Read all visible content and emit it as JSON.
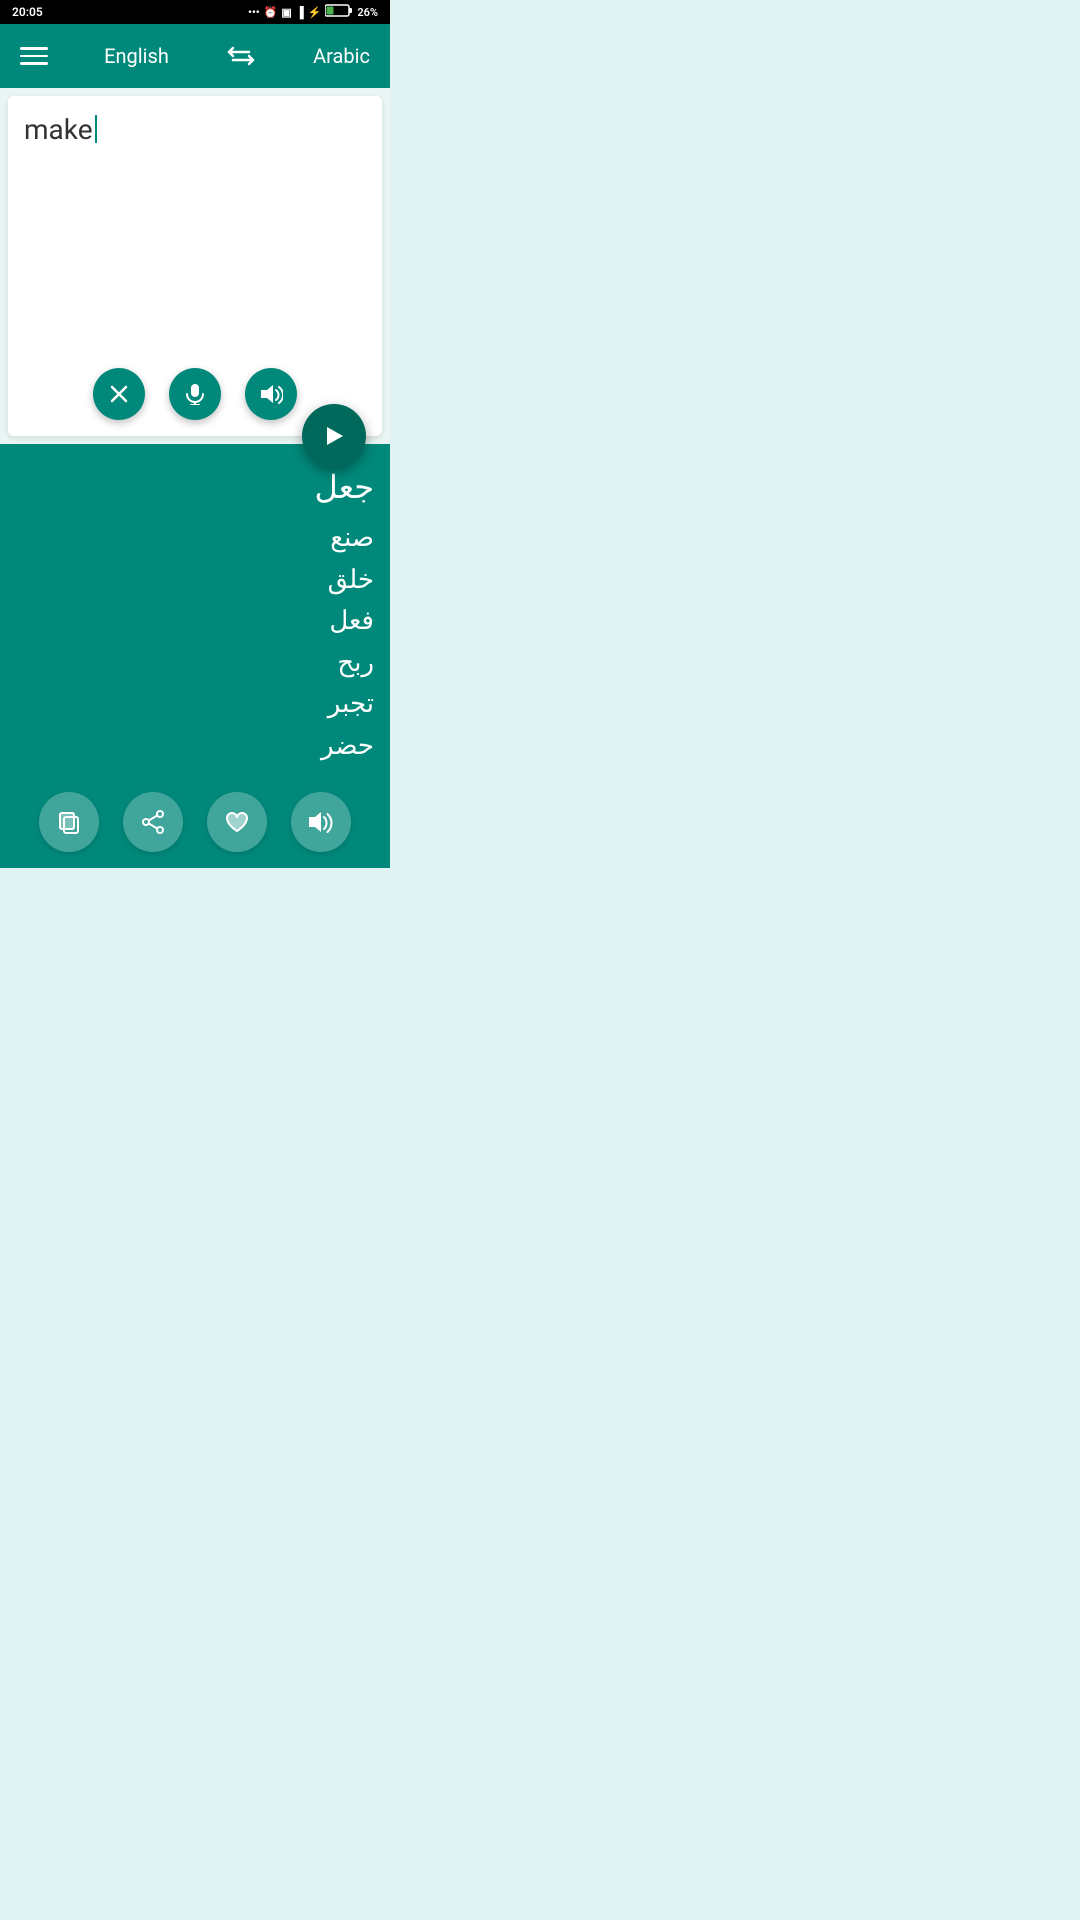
{
  "statusBar": {
    "time": "20:05",
    "battery": "26%"
  },
  "header": {
    "menuIcon": "≡",
    "sourceLang": "English",
    "swapIcon": "⇄",
    "targetLang": "Arabic"
  },
  "input": {
    "text": "make",
    "clearLabel": "×",
    "micLabel": "mic",
    "speakerLabel": "speaker"
  },
  "translateBtn": {
    "label": "▶"
  },
  "output": {
    "mainTranslation": "جعل",
    "alternatives": "صنع\nخلق\nفعل\nربح\nتجبر\nحضر",
    "copyLabel": "copy",
    "shareLabel": "share",
    "favoriteLabel": "favorite",
    "speakerLabel": "speaker"
  }
}
